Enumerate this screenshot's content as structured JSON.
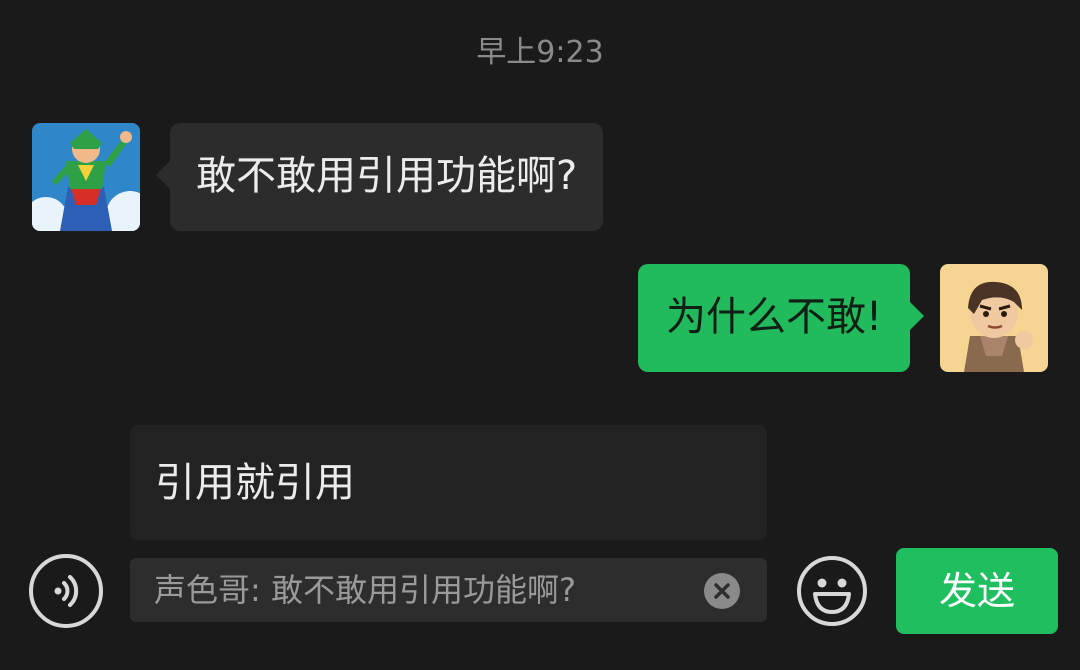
{
  "chat": {
    "timestamp": "早上9:23",
    "messages": [
      {
        "direction": "incoming",
        "text": "敢不敢用引用功能啊?",
        "avatar": "cartoon-superhero-avatar"
      },
      {
        "direction": "outgoing",
        "text": "为什么不敢!",
        "avatar": "cartoon-boy-avatar"
      }
    ]
  },
  "composer": {
    "input_value": "引用就引用",
    "quote_text": "声色哥: 敢不敢用引用功能啊?",
    "send_label": "发送",
    "icons": {
      "voice": "voice-icon",
      "clear": "clear-quote-icon",
      "emoji": "emoji-icon"
    }
  },
  "colors": {
    "background": "#1a1a1b",
    "incoming_bubble": "#2c2c2c",
    "outgoing_bubble": "#21ba5c",
    "send_button": "#1fbe5f"
  }
}
